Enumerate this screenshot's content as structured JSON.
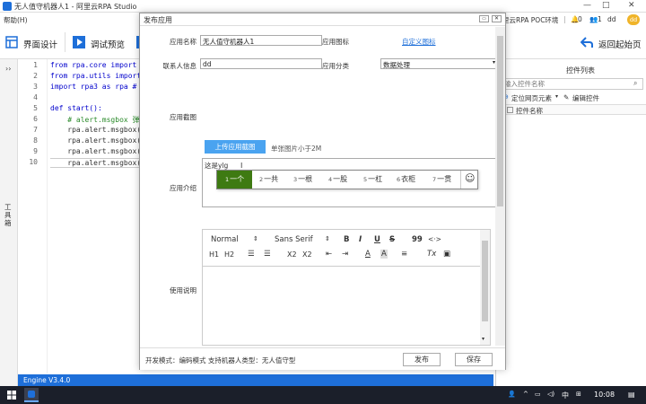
{
  "window": {
    "title": "无人值守机器人1 - 阿里云RPA Studio",
    "menu_help": "帮助(H)",
    "env_label": "里云RPA POC环境",
    "notif_count": "0",
    "user_count": "1",
    "username": "dd",
    "avatar_text": "dd"
  },
  "toolbar": {
    "design_label": "界面设计",
    "debug_label": "调试预览",
    "back_label": "返回起始页"
  },
  "sidebar": {
    "collapse": "››",
    "toolbox_label": "工具箱"
  },
  "editor": {
    "lines": [
      {
        "n": "1",
        "text": "from rpa.core import"
      },
      {
        "n": "2",
        "text": "from rpa.utils import"
      },
      {
        "n": "3",
        "text": "import rpa3 as rpa #"
      },
      {
        "n": "4",
        "text": ""
      },
      {
        "n": "5",
        "text": "def start():"
      },
      {
        "n": "6",
        "text": "    # alert.msgbox 弹"
      },
      {
        "n": "7",
        "text": "    rpa.alert.msgbox("
      },
      {
        "n": "8",
        "text": "    rpa.alert.msgbox("
      },
      {
        "n": "9",
        "text": "    rpa.alert.msgbox("
      },
      {
        "n": "10",
        "text": "    rpa.alert.msgbox("
      }
    ]
  },
  "engine": {
    "version": "Engine V3.4.0"
  },
  "controls_panel": {
    "title": "控件列表",
    "search_placeholder": "输入控件名称",
    "locate_label": "定位网页元素",
    "edit_label": "编辑控件",
    "col_name": "控件名称"
  },
  "dialog": {
    "title": "发布应用",
    "app_name_label": "应用名称",
    "app_name_value": "无人值守机器人1",
    "app_icon_label": "应用图标",
    "custom_icon_link": "自定义图标",
    "contact_label": "联系人信息",
    "contact_value": "dd",
    "category_label": "应用分类",
    "category_value": "数据处理",
    "screenshot_label": "应用截图",
    "upload_button": "上传应用截图",
    "size_hint": "单张图片小于2M",
    "intro_label": "应用介绍",
    "intro_value": "这是ylg",
    "usage_label": "使用说明",
    "footer_info": "开发模式：编码模式   支持机器人类型：无人值守型",
    "publish_button": "发布",
    "save_button": "保存"
  },
  "ime": {
    "candidates": [
      {
        "n": "1",
        "text": "一个"
      },
      {
        "n": "2",
        "text": "一共"
      },
      {
        "n": "3",
        "text": "一根"
      },
      {
        "n": "4",
        "text": "一股"
      },
      {
        "n": "5",
        "text": "一杠"
      },
      {
        "n": "6",
        "text": "衣柜"
      },
      {
        "n": "7",
        "text": "一贯"
      }
    ],
    "emoji": "☺"
  },
  "rich_toolbar": {
    "format": "Normal",
    "font": "Sans Serif",
    "bold": "B",
    "italic": "I",
    "underline": "U",
    "strike": "S",
    "quote": "99",
    "code": "<·>",
    "h1": "H1",
    "h2": "H2",
    "sub": "X2",
    "sup": "X2"
  },
  "taskbar": {
    "lang": "中",
    "time": "10:08"
  }
}
